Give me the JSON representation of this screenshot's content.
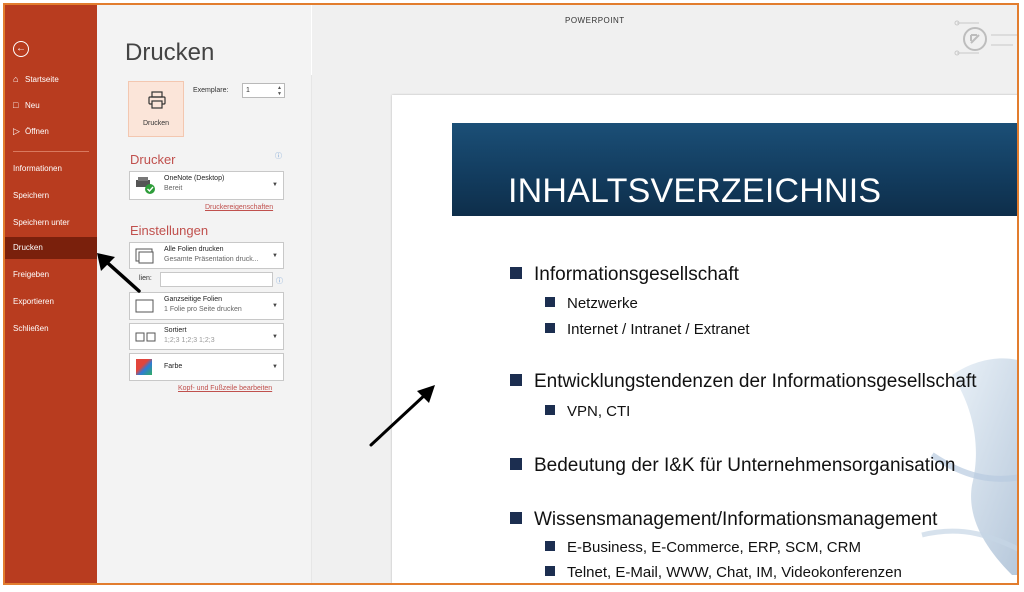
{
  "app": {
    "title": "POWERPOINT"
  },
  "sidebar": {
    "back_icon": "back-arrow-icon",
    "items": [
      {
        "label": "Startseite",
        "icon": "home-icon"
      },
      {
        "label": "Neu",
        "icon": "new-file-icon"
      },
      {
        "label": "Öffnen",
        "icon": "folder-icon"
      },
      {
        "label": "Informationen"
      },
      {
        "label": "Speichern"
      },
      {
        "label": "Speichern unter"
      },
      {
        "label": "Drucken",
        "active": true
      },
      {
        "label": "Freigeben"
      },
      {
        "label": "Exportieren"
      },
      {
        "label": "Schließen"
      }
    ]
  },
  "print": {
    "title": "Drucken",
    "button_label": "Drucken",
    "copies_label": "Exemplare:",
    "copies_value": "1",
    "printer_heading": "Drucker",
    "printer_name": "OneNote (Desktop)",
    "printer_status": "Bereit",
    "printer_properties_link": "Druckereigenschaften",
    "settings_heading": "Einstellungen",
    "range_title": "Alle Folien drucken",
    "range_sub": "Gesamte Präsentation druck...",
    "slides_label": "lien:",
    "slides_value": "",
    "layout_title": "Ganzseitige Folien",
    "layout_sub": "1 Folie pro Seite drucken",
    "collate_title": "Sortiert",
    "collate_sub": "1;2;3   1;2;3   1;2;3",
    "color_title": "Farbe",
    "header_footer_link": "Kopf- und Fußzeile bearbeiten"
  },
  "slide": {
    "title": "INHALTSVERZEICHNIS",
    "bullets": [
      {
        "level": 1,
        "text": "Informationsgesellschaft"
      },
      {
        "level": 2,
        "text": "Netzwerke"
      },
      {
        "level": 2,
        "text": "Internet / Intranet / Extranet"
      },
      {
        "level": 1,
        "text": "Entwicklungstendenzen der Informationsgesellschaft"
      },
      {
        "level": 2,
        "text": "VPN, CTI"
      },
      {
        "level": 1,
        "text": "Bedeutung der I&K für Unternehmensorganisation"
      },
      {
        "level": 1,
        "text": "Wissensmanagement/Informationsmanagement"
      },
      {
        "level": 2,
        "text": "E-Business, E-Commerce, ERP, SCM, CRM"
      },
      {
        "level": 2,
        "text": "Telnet, E-Mail, WWW, Chat, IM, Videokonferenzen"
      }
    ]
  },
  "colors": {
    "sidebar": "#b83c1f",
    "sidebar_active": "#7a200c",
    "accent": "#c0504d",
    "frame": "#e27d2e",
    "slide_banner": "#123b5d"
  }
}
